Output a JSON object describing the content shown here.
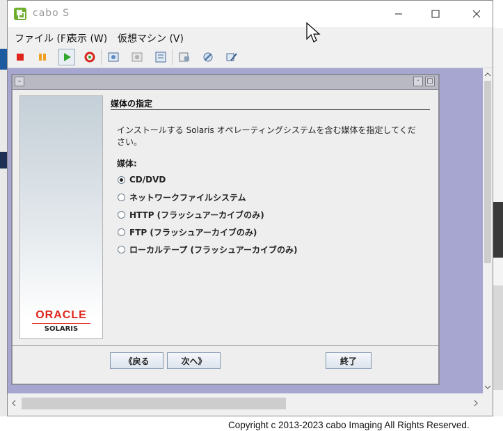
{
  "window": {
    "title": "cabo S",
    "menu": [
      "ファイル (F)",
      "表示 (W)",
      "仮想マシン (V)"
    ],
    "toolbar_icons": [
      "stop-icon",
      "pause-icon",
      "play-icon",
      "reset-icon",
      "snapshot-icon",
      "snapshot-disabled-icon",
      "snapshot-manager-icon",
      "settings-icon",
      "vm-settings-icon",
      "tools-icon"
    ]
  },
  "installer": {
    "heading": "媒体の指定",
    "description": "インストールする Solaris オペレーティングシステムを含む媒体を指定してください。",
    "medium_label": "媒体:",
    "options": [
      {
        "label": "CD/DVD",
        "selected": true
      },
      {
        "label": "ネットワークファイルシステム",
        "selected": false
      },
      {
        "label": "HTTP (フラッシュアーカイブのみ)",
        "selected": false
      },
      {
        "label": "FTP (フラッシュアーカイブのみ)",
        "selected": false
      },
      {
        "label": "ローカルテープ (フラッシュアーカイブのみ)",
        "selected": false
      }
    ],
    "buttons": {
      "back": "《戻る",
      "next": "次へ》",
      "exit": "終了"
    },
    "logo": {
      "brand": "ORACLE",
      "product": "SOLARIS"
    }
  },
  "footer": {
    "copyright": "Copyright c 2013-2023 cabo Imaging All Rights Reserved."
  },
  "colors": {
    "content_bg": "#a6a6d0",
    "oracle_red": "#e0251b"
  }
}
